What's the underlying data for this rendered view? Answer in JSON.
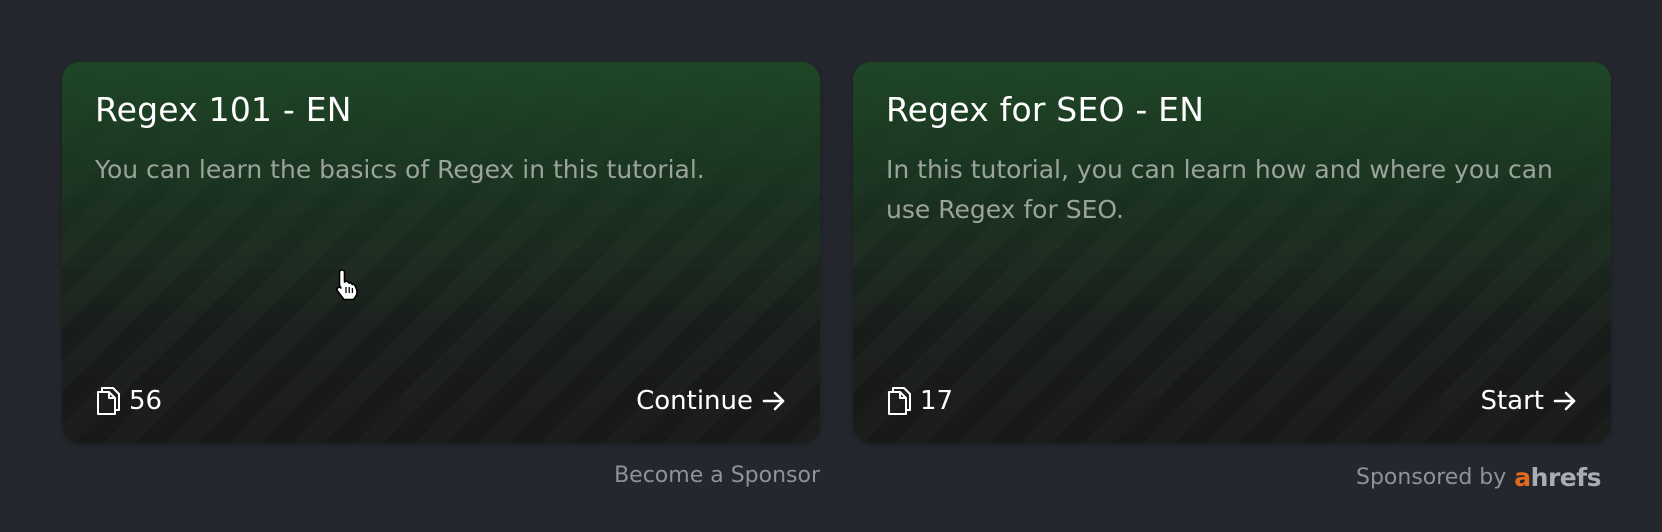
{
  "cards": [
    {
      "title": "Regex 101 - EN",
      "description": "You can learn the basics of Regex in this tutorial.",
      "count": "56",
      "count_icon": "pages-icon",
      "action_label": "Continue",
      "action_icon": "arrow-right-icon"
    },
    {
      "title": "Regex for SEO - EN",
      "description": "In this tutorial, you can learn how and where you can use Regex for SEO.",
      "count": "17",
      "count_icon": "pages-icon",
      "action_label": "Start",
      "action_icon": "arrow-right-icon"
    }
  ],
  "footer": {
    "become_sponsor": "Become a Sponsor",
    "sponsored_by": "Sponsored by",
    "sponsor_logo_a": "a",
    "sponsor_logo_rest": "hrefs"
  },
  "colors": {
    "background": "#24272d",
    "card_green": "#1e4826",
    "text_primary": "#ffffff",
    "text_secondary": "#9aa39c",
    "ahrefs_orange": "#e36b1f"
  }
}
